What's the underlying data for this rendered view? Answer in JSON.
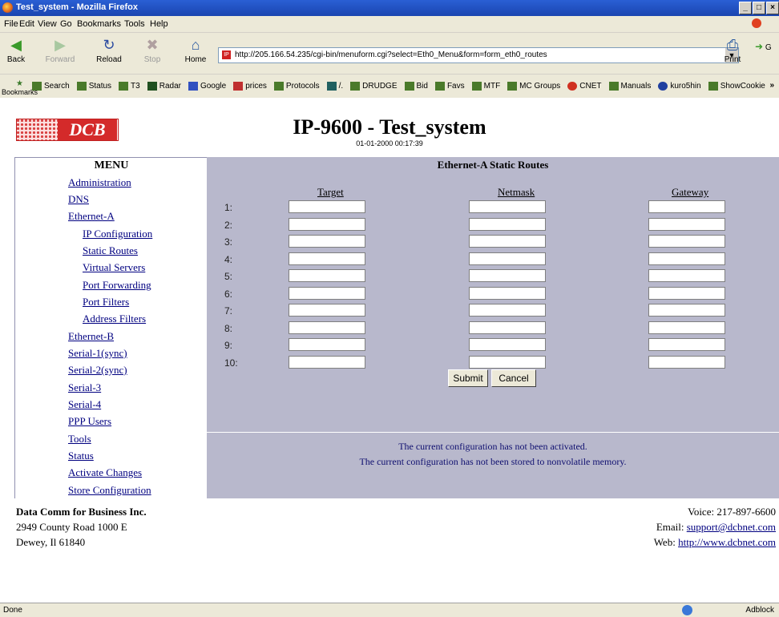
{
  "window": {
    "title": "Test_system - Mozilla Firefox",
    "controls": [
      "_",
      "□",
      "×"
    ]
  },
  "menubar": [
    "File",
    "Edit",
    "View",
    "Go",
    "Bookmarks",
    "Tools",
    "Help"
  ],
  "navbar": {
    "buttons": [
      {
        "label": "Back",
        "icon": "back-arrow-icon"
      },
      {
        "label": "Forward",
        "icon": "forward-arrow-icon"
      },
      {
        "label": "Reload",
        "icon": "reload-icon"
      },
      {
        "label": "Stop",
        "icon": "stop-icon"
      },
      {
        "label": "Home",
        "icon": "home-icon"
      }
    ],
    "url": "http://205.166.54.235/cgi-bin/menuform.cgi?select=Eth0_Menu&form=form_eth0_routes",
    "print": "Print",
    "go": "G"
  },
  "bookmarks": {
    "label": "Bookmarks",
    "items": [
      "Search",
      "Status",
      "T3",
      "Radar",
      "Google",
      "prices",
      "Protocols",
      "/.",
      "DRUDGE",
      "Bid",
      "Favs",
      "MTF",
      "MC Groups",
      "CNET",
      "Manuals",
      "kuro5hin",
      "ShowCookie"
    ],
    "more": "»"
  },
  "header": {
    "logo_text": "DCB",
    "title": "IP-9600 - Test_system",
    "timestamp": "01-01-2000 00:17:39"
  },
  "menu": {
    "heading": "MENU",
    "items": [
      "Administration",
      "DNS",
      "Ethernet-A",
      "IP Configuration",
      "Static Routes",
      "Virtual Servers",
      "Port Forwarding",
      "Port Filters",
      "Address Filters",
      "Ethernet-B",
      "Serial-1(sync)",
      "Serial-2(sync)",
      "Serial-3",
      "Serial-4",
      "PPP Users",
      "Tools",
      "Status",
      "Activate Changes",
      "Store Configuration"
    ]
  },
  "main": {
    "section_title": "Ethernet-A Static Routes",
    "columns": [
      "Target",
      "Netmask",
      "Gateway"
    ],
    "rows": [
      "1:",
      "2:",
      "3:",
      "4:",
      "5:",
      "6:",
      "7:",
      "8:",
      "9:",
      "10:"
    ],
    "submit_label": "Submit",
    "cancel_label": "Cancel",
    "messages": [
      "The current configuration has not been activated.",
      "The current configuration has not been stored to nonvolatile memory."
    ]
  },
  "footer": {
    "company": "Data Comm for Business Inc.",
    "address1": "2949 County Road 1000 E",
    "address2": "Dewey, Il 61840",
    "voice": "Voice: 217-897-6600",
    "email_label": "Email: ",
    "email": "support@dcbnet.com",
    "web_label": "Web: ",
    "web": "http://www.dcbnet.com"
  },
  "statusbar": {
    "text": "Done",
    "right": "Adblock"
  }
}
